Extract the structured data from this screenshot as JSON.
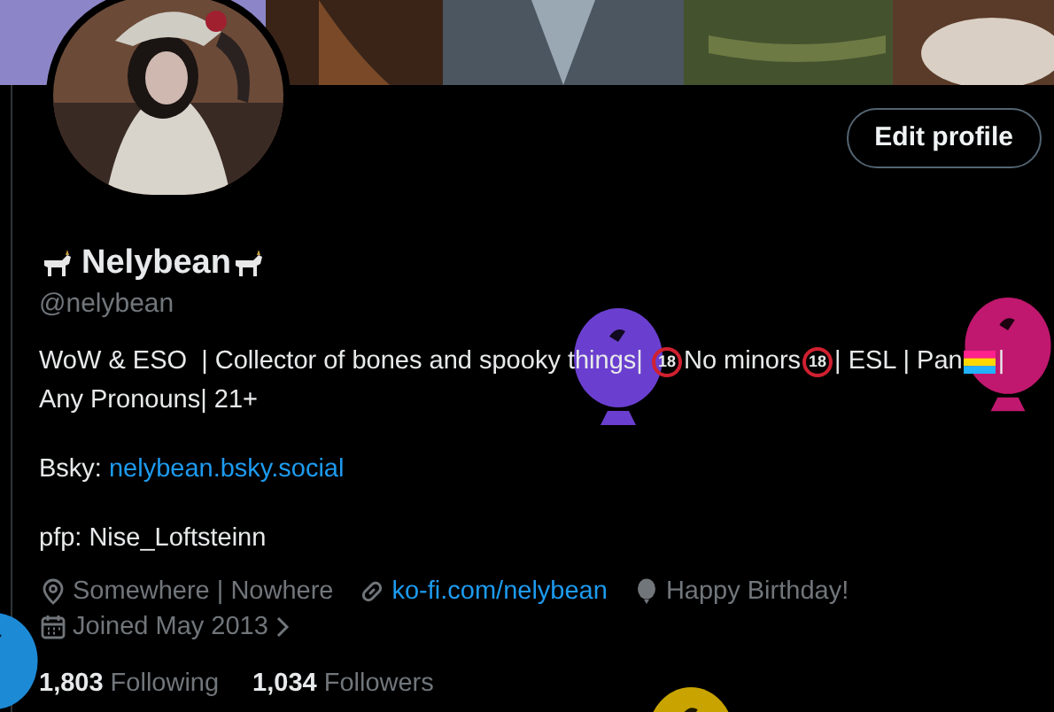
{
  "profile": {
    "name": "Nelybean",
    "handle": "@nelybean",
    "edit_button": "Edit profile"
  },
  "bio": {
    "line_1": [
      {
        "kind": "text",
        "text": "WoW & ESO  | Collector of bones and spooky things| "
      },
      {
        "kind": "badge",
        "text": "18"
      },
      {
        "kind": "text",
        "text": "No minors"
      },
      {
        "kind": "badge",
        "text": "18"
      },
      {
        "kind": "text",
        "text": "| ESL | Pan"
      },
      {
        "kind": "flag"
      },
      {
        "kind": "text",
        "text": "|"
      }
    ],
    "line_2": "Any Pronouns| 21+",
    "bsky_label": "Bsky: ",
    "bsky_link": "nelybean.bsky.social",
    "pfp": "pfp: Nise_Loftsteinn"
  },
  "meta": [
    {
      "kind": "location",
      "text": "Somewhere | Nowhere"
    },
    {
      "kind": "website",
      "text": "ko-fi.com/nelybean"
    },
    {
      "kind": "birthday",
      "text": "Happy Birthday!"
    }
  ],
  "joined": "Joined May 2013",
  "stats": [
    {
      "count": "1,803",
      "label": "Following"
    },
    {
      "count": "1,034",
      "label": "Followers"
    }
  ]
}
